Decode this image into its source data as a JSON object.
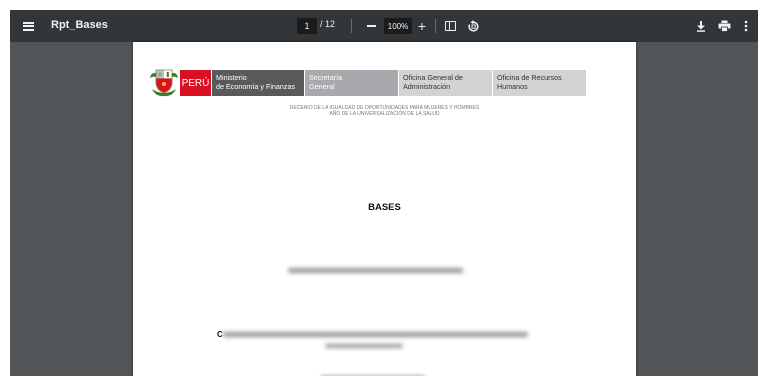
{
  "toolbar": {
    "menu_icon": "menu-icon",
    "title": "Rpt_Bases",
    "current_page": "1",
    "page_total": "/ 12",
    "zoom_level": "100%",
    "zoom_in_label": "+",
    "icons": {
      "zoom_out": "minus-icon",
      "fit": "fit-to-page-icon",
      "rotate": "rotate-icon",
      "download": "download-icon",
      "print": "print-icon",
      "more": "more-vertical-icon"
    },
    "colors": {
      "background": "#323639",
      "viewer": "#525659"
    }
  },
  "document": {
    "header": {
      "peru": "PERÚ",
      "mef_line1": "Ministerio",
      "mef_line2": "de Economía y Finanzas",
      "sg_line1": "Secretaría",
      "sg_line2": "General",
      "oga_line1": "Oficina General de",
      "oga_line2": "Administración",
      "orh_line1": "Oficina de Recursos",
      "orh_line2": "Humanos",
      "colors": {
        "peru_red": "#d91023",
        "mef": "#58595b",
        "sg": "#a7a9ac",
        "office": "#d1d3d4"
      }
    },
    "decenio_line1": "DECENIO DE LA IGUALDAD DE OPORTUNIDADES PARA MUJERES Y HOMBRES",
    "decenio_line2": "AÑO DE LA UNIVERSALIZACIÓN DE LA SALUD",
    "title": "BASES",
    "convocatoria_initial": "C"
  }
}
